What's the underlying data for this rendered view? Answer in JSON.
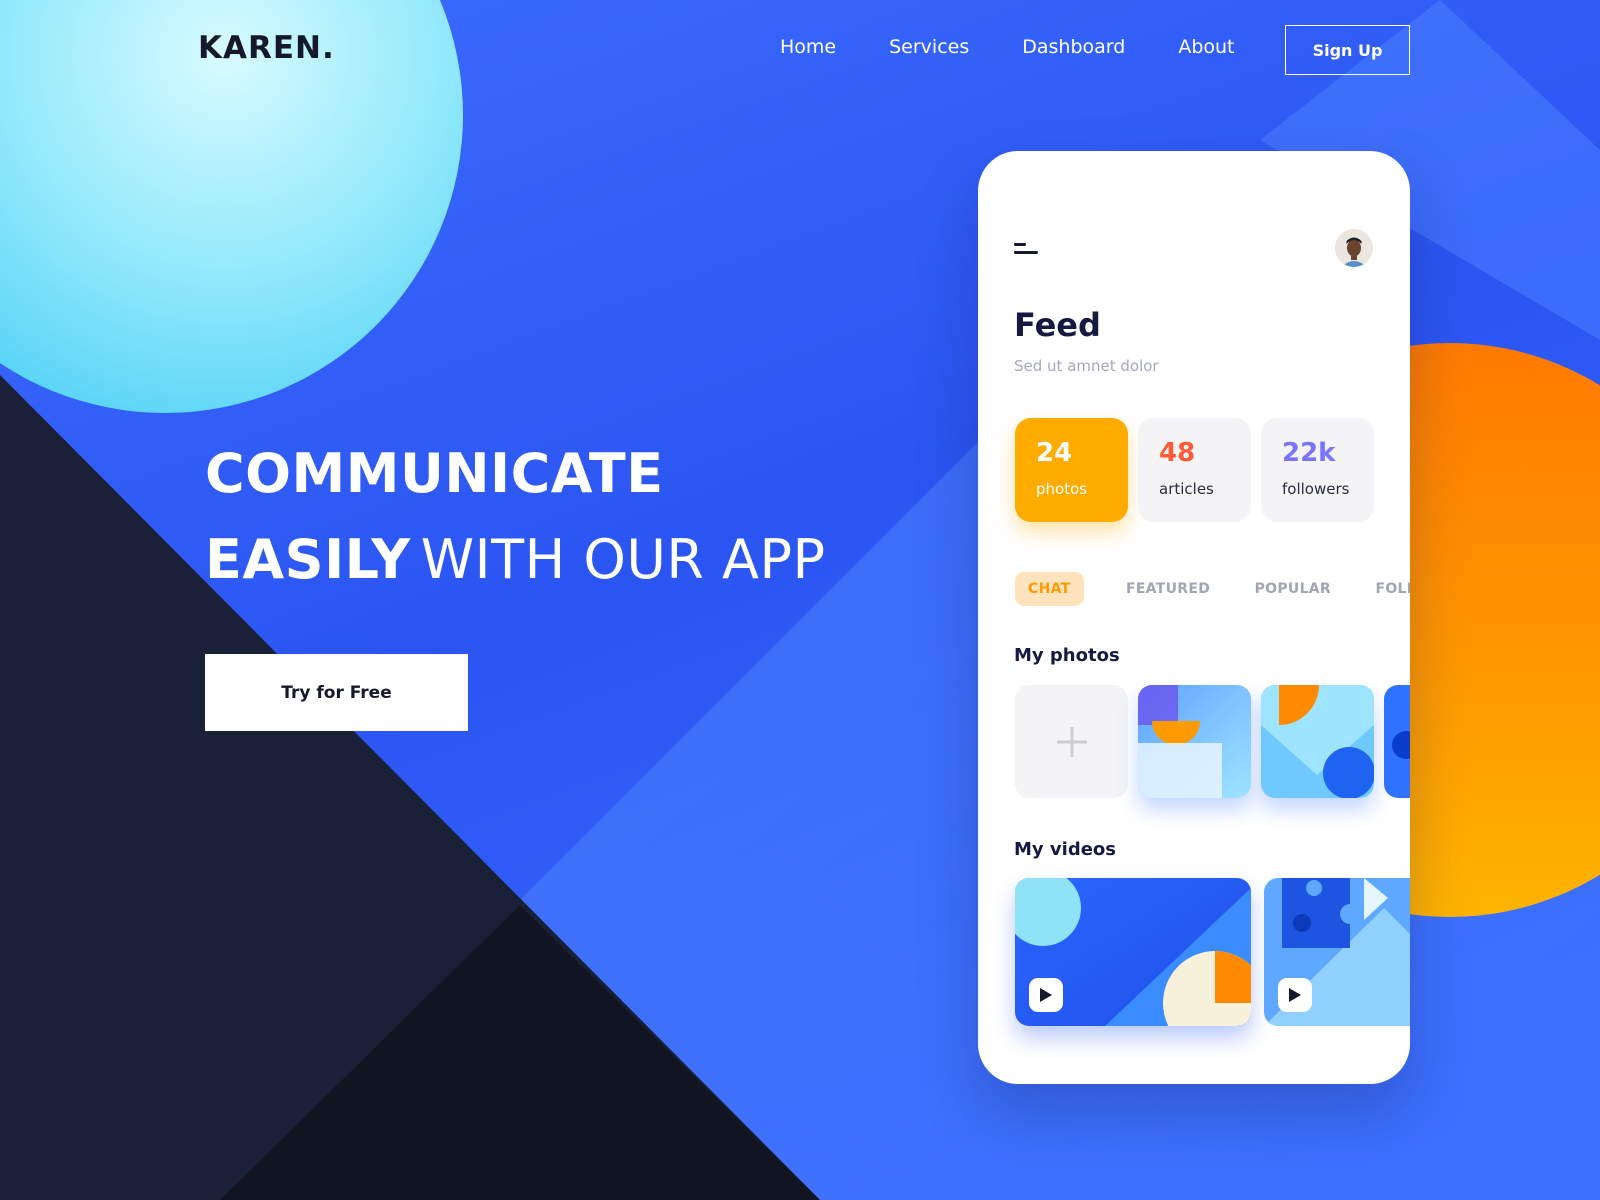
{
  "header": {
    "logo": "KAREN.",
    "nav": [
      "Home",
      "Services",
      "Dashboard",
      "About"
    ],
    "signup": "Sign Up"
  },
  "hero": {
    "line1": "COMMUNICATE",
    "line2_bold": "EASILY",
    "line2_light": "WITH OUR APP",
    "cta": "Try for Free"
  },
  "app": {
    "title": "Feed",
    "subtitle": "Sed ut amnet dolor",
    "stats": [
      {
        "value": "24",
        "label": "photos"
      },
      {
        "value": "48",
        "label": "articles"
      },
      {
        "value": "22k",
        "label": "followers"
      }
    ],
    "tabs": [
      "CHAT",
      "FEATURED",
      "POPULAR",
      "FOLLO"
    ],
    "photos_title": "My photos",
    "videos_title": "My videos"
  },
  "colors": {
    "background": "#2b55f2",
    "accent_orange": "#ffab00",
    "dark": "#16182b",
    "articles": "#ff5a36",
    "followers": "#7a73ff"
  }
}
